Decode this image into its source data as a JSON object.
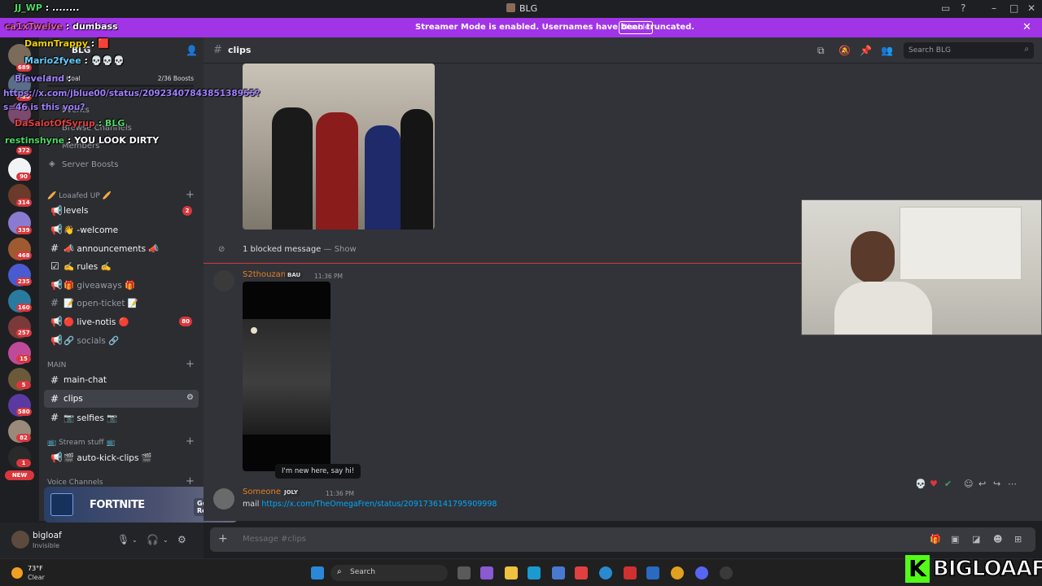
{
  "window": {
    "title": "BLG"
  },
  "banner": {
    "message": "Streamer Mode is enabled. Usernames have been truncated.",
    "button": "Disable"
  },
  "server_rail": {
    "badges": [
      "689",
      "486",
      "372",
      "90",
      "314",
      "339",
      "468",
      "235",
      "160",
      "257",
      "15",
      "5",
      "580",
      "82",
      "1"
    ],
    "new_label": "NEW"
  },
  "server": {
    "name": "BLG",
    "boost_goal": "Boost Goal",
    "boost_count": "2/36 Boosts",
    "events": "Events",
    "browse_channels": "Browse Channels",
    "members": "Members",
    "server_boosts": "Server Boosts"
  },
  "categories": {
    "loafed": "🥖 Loaafed UP 🥖",
    "main": "MAIN",
    "stream": "📺 Stream stuff 📺",
    "voice": "Voice Channels"
  },
  "channels": [
    {
      "name": "levels",
      "badge": "2"
    },
    {
      "name": "👋 -welcome",
      "badge": ""
    },
    {
      "name": "📣 announcements 📣",
      "badge": ""
    },
    {
      "name": "✍️ rules ✍️",
      "badge": ""
    },
    {
      "name": "🎁 giveaways 🎁",
      "badge": ""
    },
    {
      "name": "📝 open-ticket 📝",
      "badge": ""
    },
    {
      "name": "🔴 live-notis 🔴",
      "badge": "80"
    },
    {
      "name": "🔗 socials 🔗",
      "badge": ""
    },
    {
      "name": "main-chat",
      "badge": ""
    },
    {
      "name": "clips",
      "badge": ""
    },
    {
      "name": "📷 selfies 📷",
      "badge": ""
    },
    {
      "name": "🎬 auto-kick-clips 🎬",
      "badge": ""
    }
  ],
  "promo": {
    "brand": "FORTNITE",
    "cta": "Get Reward!"
  },
  "user": {
    "name": "bigloaf",
    "status": "Invisible"
  },
  "header": {
    "channel": "clips",
    "search_placeholder": "Search BLG"
  },
  "messages": {
    "blocked": "1 blocked message",
    "blocked_sep": " — ",
    "show": "Show",
    "msg1": {
      "author": "S2thouzan",
      "tag": "BAU",
      "time": "11:36 PM"
    },
    "tooltip": "I'm new here, say hi!",
    "msg2": {
      "author": "Someone",
      "tag": "JOLY",
      "time": "11:36 PM",
      "prefix": "mail",
      "link": "https://x.com/TheOmegaFren/status/2091736141795909998"
    }
  },
  "composer": {
    "placeholder": "Message #clips"
  },
  "taskbar": {
    "temp": "73°F",
    "condition": "Clear",
    "search": "Search"
  },
  "stream_overlay": {
    "brand_letter": "K",
    "brand": "BIGLOAAF",
    "chat": [
      {
        "user": "JJ_WP",
        "text": ": ........",
        "color": "#4cd964"
      },
      {
        "user": "ca1xTwelve",
        "text": ": dumbass",
        "color": "#e05aa0"
      },
      {
        "user": "DamnTrappy",
        "text": ": 🟥",
        "color": "#f0d000"
      },
      {
        "user": "Mario2fyee",
        "text": ": 💀💀💀",
        "color": "#66ccff"
      },
      {
        "user": "Bleveland",
        "text": ":",
        "color": "#a080ff"
      },
      {
        "user": "",
        "text": "https://x.com/jblue00/status/2092340784385138955?s=46 is this you?",
        "color": "#a080ff"
      },
      {
        "user": "DaSalotOfSyrup",
        "text": ": BLG",
        "color": "#e04040"
      },
      {
        "user": "restinshyne",
        "text": ": YOU LOOK DIRTY",
        "color": "#4cd964"
      }
    ]
  }
}
